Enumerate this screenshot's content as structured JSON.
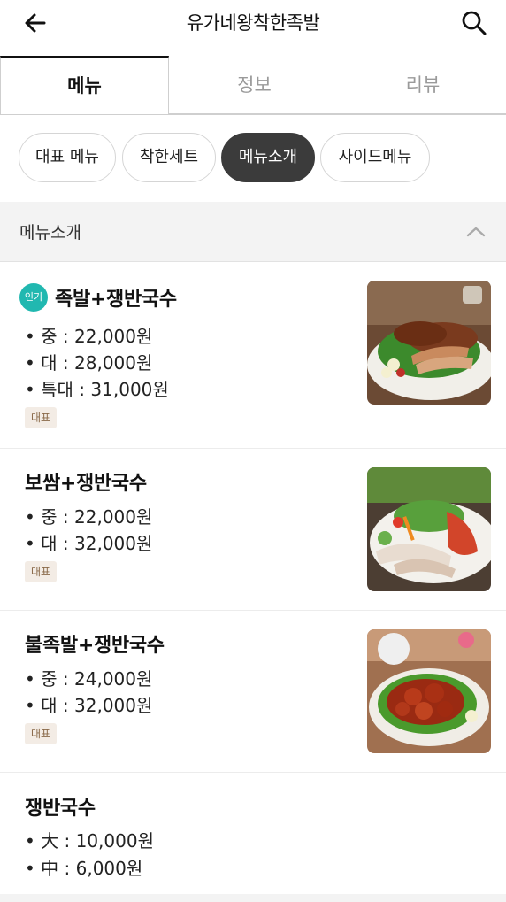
{
  "header": {
    "title": "유가네왕착한족발",
    "back_icon": "arrow-left-icon",
    "search_icon": "search-icon"
  },
  "tabs": [
    {
      "label": "메뉴",
      "active": true
    },
    {
      "label": "정보",
      "active": false
    },
    {
      "label": "리뷰",
      "active": false
    }
  ],
  "chips": [
    {
      "label": "대표 메뉴",
      "active": false
    },
    {
      "label": "착한세트",
      "active": false
    },
    {
      "label": "메뉴소개",
      "active": true
    },
    {
      "label": "사이드메뉴",
      "active": false
    }
  ],
  "section": {
    "title": "메뉴소개",
    "toggle_icon": "chevron-up-icon"
  },
  "items": [
    {
      "badge": "인기",
      "name": "족발+쟁반국수",
      "prices": [
        "• 중 : 22,000원",
        "• 대 : 28,000원",
        "• 특대 : 31,000원"
      ],
      "tag": "대표",
      "image": "jokbal-platter-photo"
    },
    {
      "name": "보쌈+쟁반국수",
      "prices": [
        "• 중 : 22,000원",
        "• 대 : 32,000원"
      ],
      "tag": "대표",
      "image": "bossam-platter-photo"
    },
    {
      "name": "불족발+쟁반국수",
      "prices": [
        "• 중 : 24,000원",
        "• 대 : 32,000원"
      ],
      "tag": "대표",
      "image": "spicy-jokbal-photo"
    },
    {
      "name": "쟁반국수",
      "prices": [
        "• 大 : 10,000원",
        "• 中 : 6,000원"
      ]
    }
  ],
  "colors": {
    "badge": "#21b8b0",
    "active_chip": "#3b3b3b",
    "tag_bg": "#f3ece5",
    "tag_text": "#8a6a4a"
  }
}
